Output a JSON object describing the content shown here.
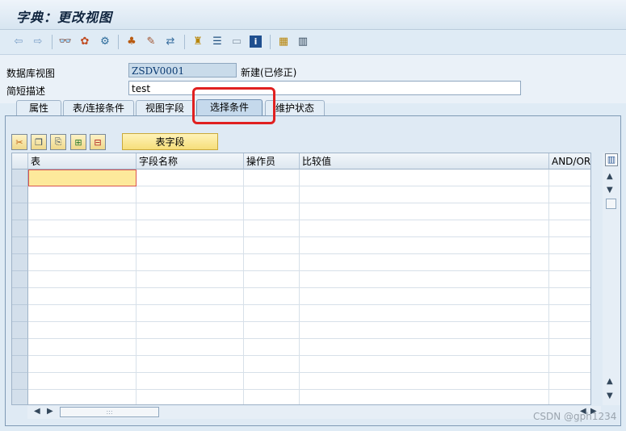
{
  "window": {
    "title": "字典：更改视图"
  },
  "toolbar": {
    "icons": [
      "back-arrow",
      "forward-arrow",
      "glasses",
      "other-object",
      "activate",
      "hierarchy",
      "pencil",
      "where-used",
      "org-structure",
      "list",
      "display-object",
      "info",
      "buttons",
      "grid"
    ]
  },
  "form": {
    "view_label": "数据库视图",
    "view_value": "ZSDV0001",
    "view_status": "新建(已修正)",
    "desc_label": "简短描述",
    "desc_value": "test"
  },
  "tabs": [
    {
      "label": "属性"
    },
    {
      "label": "表/连接条件"
    },
    {
      "label": "视图字段"
    },
    {
      "label": "选择条件"
    },
    {
      "label": "维护状态"
    }
  ],
  "selection_tab": {
    "table_fields_button": "表字段",
    "columns": [
      "表",
      "字段名称",
      "操作员",
      "比较值",
      "AND/OR"
    ]
  },
  "watermark": "CSDN @gph1234",
  "colors": {
    "accent": "#e02020",
    "field_highlight": "#fde99b"
  }
}
